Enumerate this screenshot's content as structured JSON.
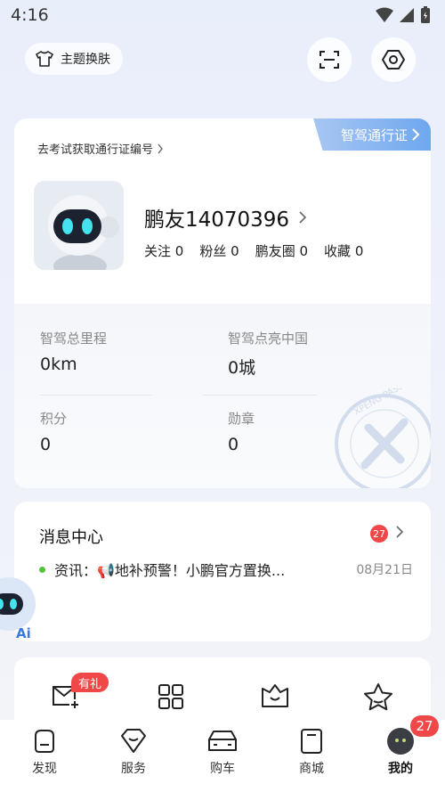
{
  "status_bar": {
    "time": "4:16"
  },
  "header": {
    "theme_label": "主题换肤",
    "scan_icon": "scan-icon",
    "settings_icon": "hexagon-settings-icon"
  },
  "profile": {
    "passport_tab": "智驾通行证",
    "exam_link": "去考试获取通行证编号",
    "username": "鹏友14070396",
    "stats": [
      {
        "label": "关注",
        "value": "0"
      },
      {
        "label": "粉丝",
        "value": "0"
      },
      {
        "label": "鹏友圈",
        "value": "0"
      },
      {
        "label": "收藏",
        "value": "0"
      }
    ],
    "metrics": [
      {
        "label": "智驾总里程",
        "value": "0km"
      },
      {
        "label": "智驾点亮中国",
        "value": "0城"
      },
      {
        "label": "积分",
        "value": "0"
      },
      {
        "label": "勋章",
        "value": "0"
      }
    ],
    "seal_text": "XPENG PASSPORT"
  },
  "messages": {
    "title": "消息中心",
    "unread_count": "27",
    "item": {
      "text": "资讯：📢地补预警！小鹏官方置换...",
      "date": "08月21日"
    }
  },
  "ai_assistant": {
    "label": "Ai"
  },
  "shortcuts": {
    "gift_badge": "有礼",
    "icons": [
      "mail-plus-icon",
      "grid-icon",
      "basket-icon",
      "star-icon"
    ]
  },
  "tabs": [
    {
      "label": "发现",
      "icon": "discover-icon"
    },
    {
      "label": "服务",
      "icon": "diamond-icon"
    },
    {
      "label": "购车",
      "icon": "car-icon"
    },
    {
      "label": "商城",
      "icon": "bag-icon"
    },
    {
      "label": "我的",
      "icon": "avatar-icon"
    }
  ],
  "tab_badge": "27",
  "colors": {
    "badge_red": "#f04848",
    "accent_blue": "#6ea7ef",
    "dot_green": "#55c23a"
  }
}
